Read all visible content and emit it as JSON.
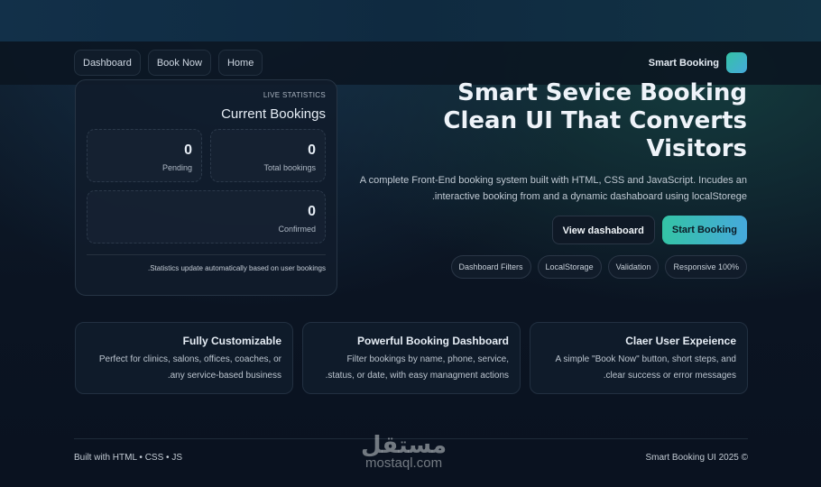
{
  "nav": {
    "items": [
      "Dashboard",
      "Book Now",
      "Home"
    ],
    "brand": "Smart Booking"
  },
  "stats": {
    "live": "LIVE STATISTICS",
    "title": "Current Bookings",
    "items": [
      {
        "value": "0",
        "label": "Pending"
      },
      {
        "value": "0",
        "label": "Total bookings"
      },
      {
        "value": "0",
        "label": "Confirmed"
      }
    ],
    "note": ".Statistics update automatically based on user bookings"
  },
  "hero": {
    "title1": "Smart Sevice Booking",
    "title2": "Clean UI That Converts Visitors",
    "desc1": "A complete Front-End booking system built with HTML, CSS and JavaScript. Incudes an",
    "desc2": ".interactive booking from and a dynamic dashaboard using localStorege",
    "view_btn": "View dashaboard",
    "start_btn": "Start Booking",
    "tags": [
      "Dashboard Filters",
      "LocalStorage",
      "Validation",
      "Responsive 100%"
    ]
  },
  "cards": [
    {
      "title": "Fully Customizable",
      "d1": "Perfect for clinics, salons, offices, coaches, or",
      "d2": ".any service-based business"
    },
    {
      "title": "Powerful Booking Dashboard",
      "d1": "Filter bookings by name, phone, service,",
      "d2": ".status, or date, with easy managment actions"
    },
    {
      "title": "Claer User Expeience",
      "d1": "A simple \"Book Now\" button, short steps, and",
      "d2": ".clear success or error messages"
    }
  ],
  "footer": {
    "left": "Built with HTML • CSS • JS",
    "right": "Smart Booking UI 2025 ©",
    "watermark_ar": "مستقل",
    "watermark": "mostaql.com"
  },
  "colors": {
    "accent1": "#34c3a5",
    "accent2": "#46a9dc"
  }
}
